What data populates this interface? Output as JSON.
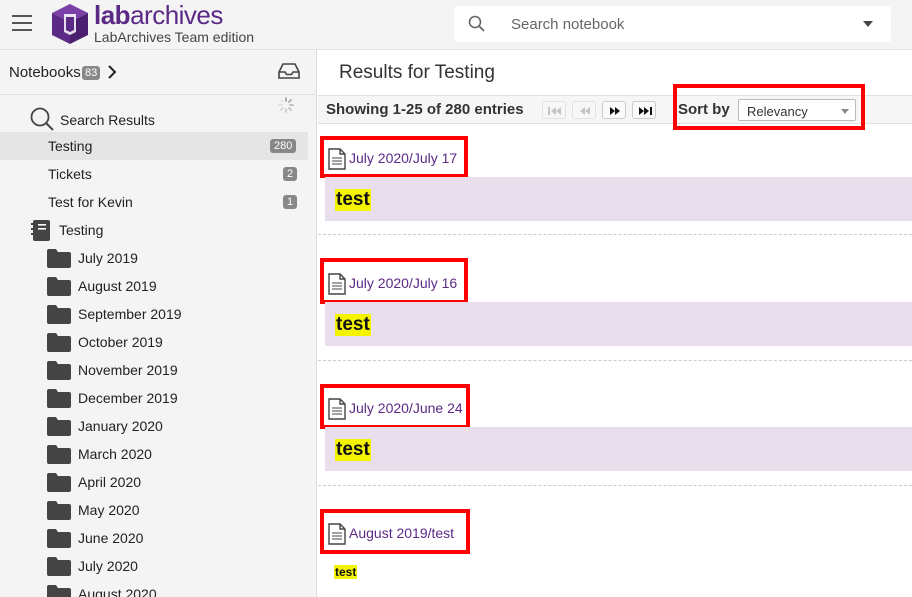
{
  "header": {
    "logo_word_bold": "lab",
    "logo_word_rest": "archives",
    "logo_subtitle": "LabArchives Team edition",
    "search_placeholder": "Search notebook"
  },
  "sidebar": {
    "notebooks_label": "Notebooks",
    "notebooks_count": "83",
    "search_results_label": "Search Results",
    "results": [
      {
        "label": "Testing",
        "count": "280",
        "selected": true
      },
      {
        "label": "Tickets",
        "count": "2",
        "selected": false
      },
      {
        "label": "Test for Kevin",
        "count": "1",
        "selected": false
      }
    ],
    "notebook_name": "Testing",
    "folders": [
      "July 2019",
      "August 2019",
      "September 2019",
      "October 2019",
      "November 2019",
      "December 2019",
      "January 2020",
      "March 2020",
      "April 2020",
      "May 2020",
      "June 2020",
      "July 2020",
      "August 2020"
    ]
  },
  "main": {
    "title": "Results for Testing",
    "showing": "Showing 1-25 of 280 entries",
    "sort_label": "Sort by",
    "sort_value": "Relevancy",
    "entries": [
      {
        "link": "July 2020/July 17",
        "snippet": "test"
      },
      {
        "link": "July 2020/July 16",
        "snippet": "test"
      },
      {
        "link": "July 2020/June 24",
        "snippet": "test"
      },
      {
        "link": "August 2019/test",
        "snippet": "test"
      }
    ]
  },
  "colors": {
    "brand_purple": "#5b2a86",
    "highlight_yellow": "#f4f400",
    "snippet_bg": "#e9dfec",
    "annotation_red": "#ff0000"
  },
  "icons": [
    "hamburger-icon",
    "logo-cube-icon",
    "search-icon",
    "chevron-down-icon",
    "chevron-right-icon",
    "inbox-icon",
    "spinner-icon",
    "magnifier-icon",
    "notebook-icon",
    "folder-icon",
    "document-icon",
    "first-page-icon",
    "prev-page-icon",
    "next-page-icon",
    "last-page-icon"
  ]
}
